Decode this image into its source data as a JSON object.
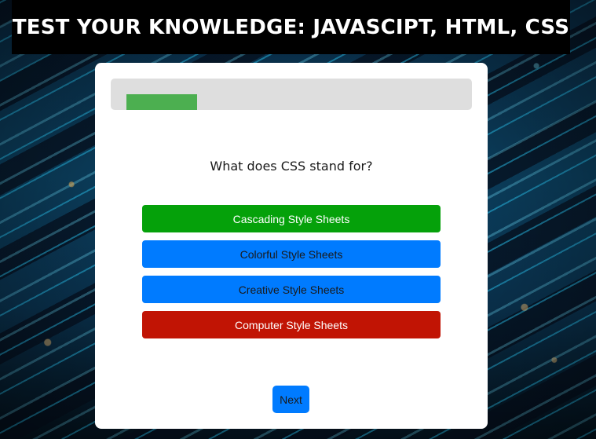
{
  "header": {
    "title": "TEST YOUR KNOWLEDGE: JAVASCIPT, HTML, CSS"
  },
  "quiz": {
    "progress_fraction": 0.2,
    "question": "What does CSS stand for?",
    "answers": [
      {
        "label": "Cascading Style Sheets",
        "state": "correct"
      },
      {
        "label": "Colorful Style Sheets",
        "state": "neutral"
      },
      {
        "label": "Creative Style Sheets",
        "state": "neutral"
      },
      {
        "label": "Computer Style Sheets",
        "state": "wrong"
      }
    ],
    "next_label": "Next"
  },
  "colors": {
    "correct": "#05a10a",
    "neutral": "#007bff",
    "wrong": "#c11404",
    "progress": "#4caf50",
    "track": "#dedede"
  }
}
